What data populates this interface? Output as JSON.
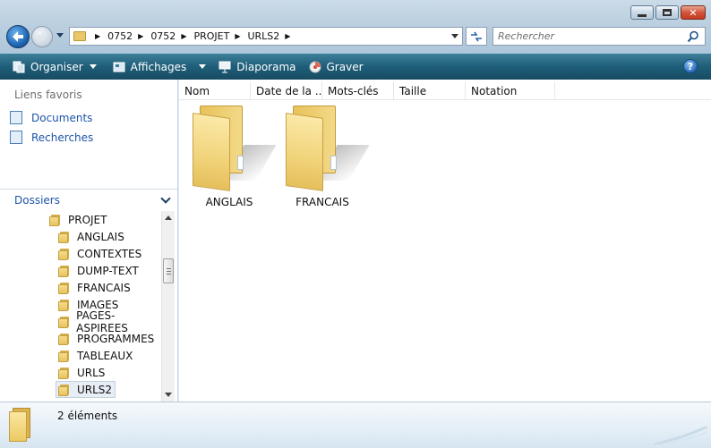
{
  "window": {
    "buttons": [
      "minimize",
      "maximize",
      "close"
    ]
  },
  "address": {
    "breadcrumbs": [
      "0752",
      "0752",
      "PROJET",
      "URLS2"
    ]
  },
  "search": {
    "placeholder": "Rechercher"
  },
  "toolbar": {
    "organize_label": "Organiser",
    "views_label": "Affichages",
    "slideshow_label": "Diaporama",
    "burn_label": "Graver",
    "help_label": "?"
  },
  "sidebar": {
    "favorites_title": "Liens favoris",
    "favorites": [
      {
        "label": "Documents",
        "icon": "documents-icon"
      },
      {
        "label": "Recherches",
        "icon": "searches-icon"
      }
    ],
    "folders_title": "Dossiers",
    "tree": [
      {
        "label": "PROJET",
        "level": 1,
        "selected": false
      },
      {
        "label": "ANGLAIS",
        "level": 2,
        "selected": false
      },
      {
        "label": "CONTEXTES",
        "level": 2,
        "selected": false
      },
      {
        "label": "DUMP-TEXT",
        "level": 2,
        "selected": false
      },
      {
        "label": "FRANCAIS",
        "level": 2,
        "selected": false
      },
      {
        "label": "IMAGES",
        "level": 2,
        "selected": false
      },
      {
        "label": "PAGES-ASPIREES",
        "level": 2,
        "selected": false
      },
      {
        "label": "PROGRAMMES",
        "level": 2,
        "selected": false
      },
      {
        "label": "TABLEAUX",
        "level": 2,
        "selected": false
      },
      {
        "label": "URLS",
        "level": 2,
        "selected": false
      },
      {
        "label": "URLS2",
        "level": 2,
        "selected": true
      }
    ]
  },
  "main": {
    "columns": [
      "Nom",
      "Date de la ...",
      "Mots-clés",
      "Taille",
      "Notation"
    ],
    "items": [
      {
        "label": "ANGLAIS"
      },
      {
        "label": "FRANCAIS"
      }
    ]
  },
  "status": {
    "count_text": "2 éléments"
  },
  "colors": {
    "toolbar": "#1f5e79",
    "link": "#1c55a8",
    "folder": "#f1d37a"
  }
}
